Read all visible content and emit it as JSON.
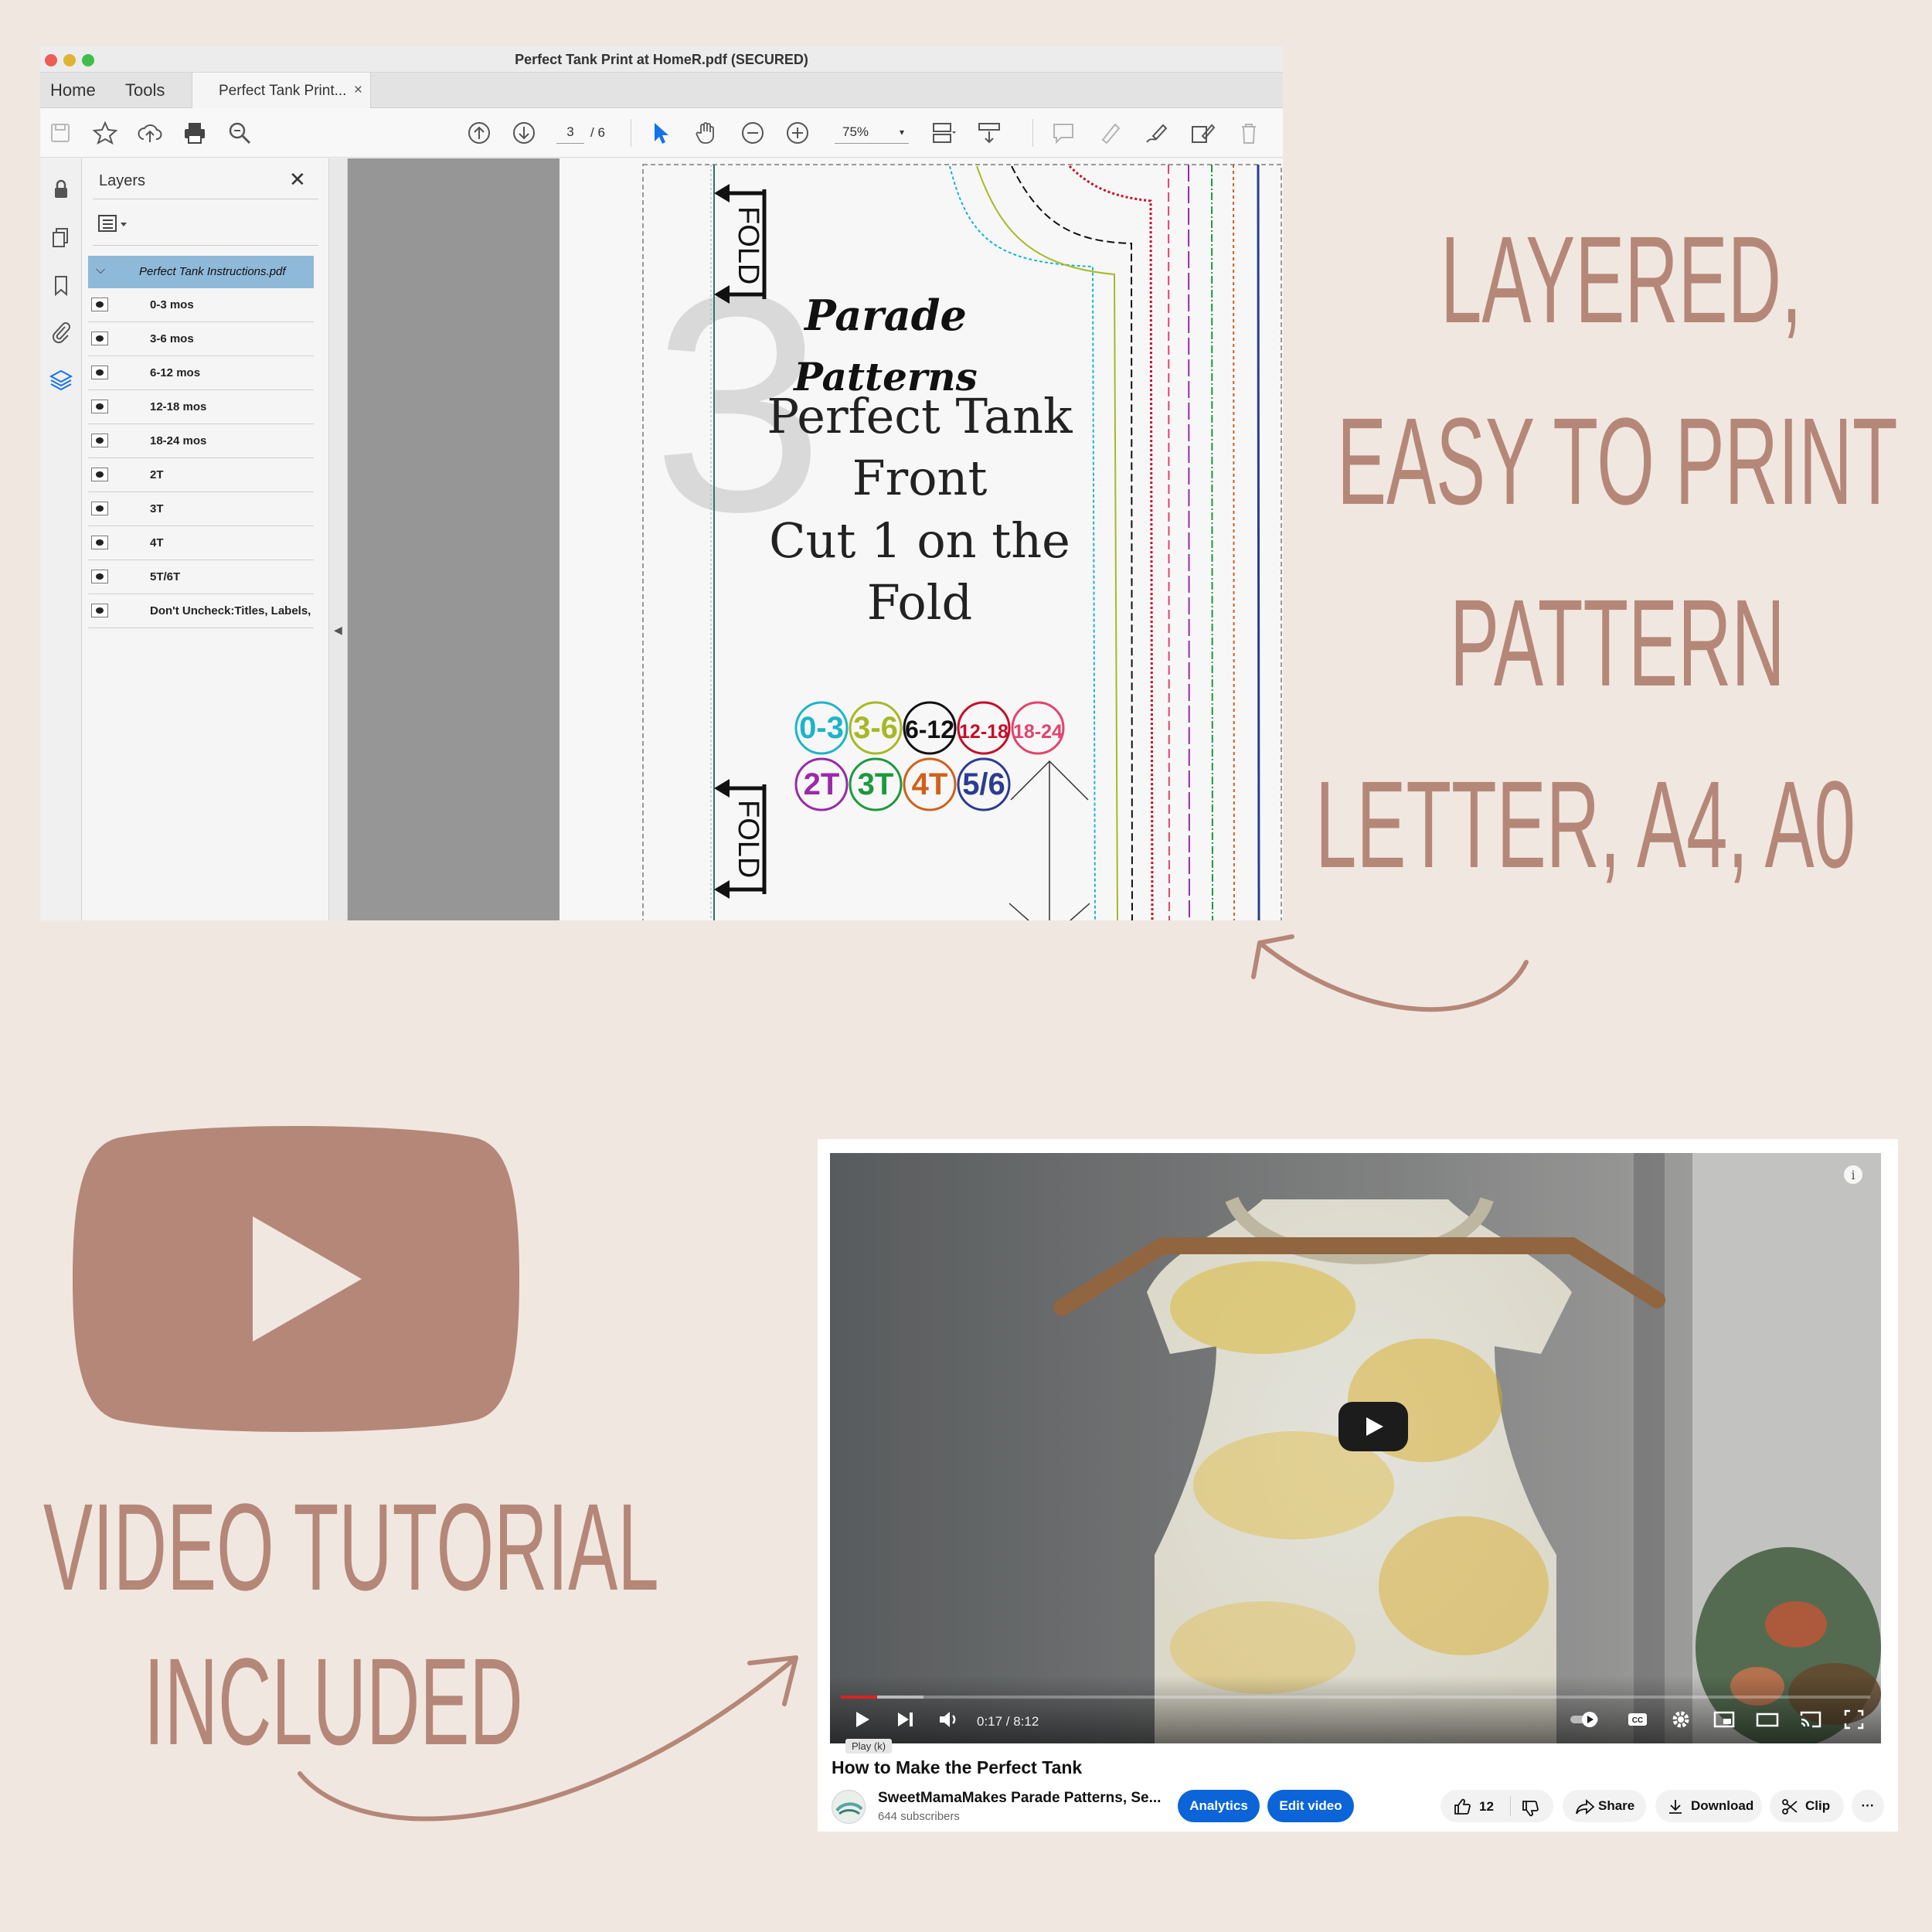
{
  "pdf_window": {
    "title": "Perfect Tank Print at HomeR.pdf (SECURED)",
    "menu": [
      "Home",
      "Tools"
    ],
    "tab_label": "Perfect Tank Print...",
    "tab_close": "×",
    "page_current": "3",
    "page_total": "/ 6",
    "zoom": "75%",
    "layers_title": "Layers",
    "layers_close": "✕",
    "layers_root": "Perfect Tank Instructions.pdf",
    "layers": [
      "0-3 mos",
      "3-6 mos",
      "6-12 mos",
      "12-18 mos",
      "18-24 mos",
      "2T",
      "3T",
      "4T",
      "5T/6T",
      "Don't Uncheck:Titles, Labels,"
    ],
    "pattern": {
      "big_number": "3",
      "fold_label": "FOLD",
      "brand_line1": "Parade",
      "brand_line2": "Patterns",
      "title_lines": [
        "Perfect Tank",
        "Front",
        "Cut 1 on the",
        "Fold"
      ],
      "sizes_row1": [
        {
          "label": "0-3",
          "color": "#1cb5c9"
        },
        {
          "label": "3-6",
          "color": "#a8b825"
        },
        {
          "label": "6-12",
          "color": "#111111"
        },
        {
          "label": "12-18",
          "color": "#c3102a"
        },
        {
          "label": "18-24",
          "color": "#e0456f"
        }
      ],
      "sizes_row2": [
        {
          "label": "2T",
          "color": "#9a2aa8"
        },
        {
          "label": "3T",
          "color": "#1b9a3c"
        },
        {
          "label": "4T",
          "color": "#d0611a"
        },
        {
          "label": "5/6",
          "color": "#2b3d8f"
        }
      ]
    }
  },
  "promo": {
    "right_lines": [
      "LAYERED,",
      "EASY TO PRINT",
      "PATTERN",
      "LETTER, A4, A0"
    ],
    "left_lines": [
      "VIDEO TUTORIAL",
      "INCLUDED"
    ],
    "accent_color": "#b58778"
  },
  "youtube": {
    "time": "0:17 / 8:12",
    "progress_fraction": 0.035,
    "tooltip": "Play (k)",
    "title": "How to Make the Perfect Tank",
    "channel": "SweetMamaMakes Parade Patterns, Se...",
    "subscribers": "644 subscribers",
    "analytics_label": "Analytics",
    "edit_label": "Edit video",
    "likes": "12",
    "share_label": "Share",
    "download_label": "Download",
    "clip_label": "Clip",
    "more_label": "···"
  }
}
